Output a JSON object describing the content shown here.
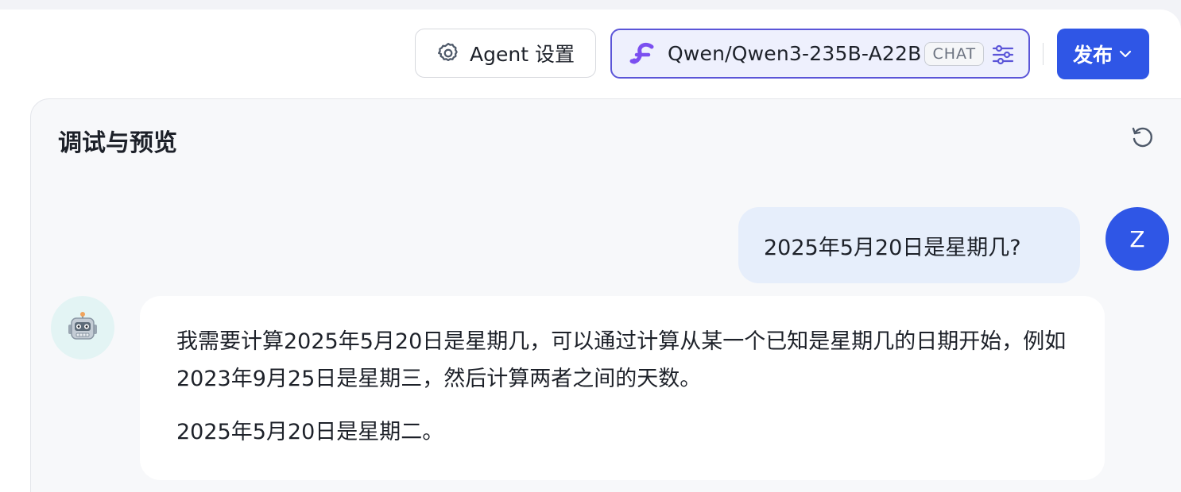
{
  "toolbar": {
    "agent_settings_label": "Agent 设置",
    "model": {
      "name": "Qwen/Qwen3-235B-A22B",
      "tag": "CHAT"
    },
    "publish_label": "发布"
  },
  "panel": {
    "title": "调试与预览"
  },
  "chat": {
    "user_message": "2025年5月20日是星期几?",
    "user_avatar_letter": "Z",
    "assistant_paragraphs": [
      "我需要计算2025年5月20日是星期几，可以通过计算从某一个已知是星期几的日期开始，例如2023年9月25日是星期三，然后计算两者之间的天数。",
      "2025年5月20日是星期二。"
    ]
  },
  "colors": {
    "accent": "#2f56e6",
    "model_border": "#5b55d8",
    "user_bubble": "#e6eefb"
  },
  "icons": {
    "agent_settings": "gear-icon",
    "model_logo": "siliconflow-logo-icon",
    "model_settings": "sliders-icon",
    "publish_caret": "chevron-down-icon",
    "refresh": "refresh-icon",
    "bot": "robot-icon"
  }
}
